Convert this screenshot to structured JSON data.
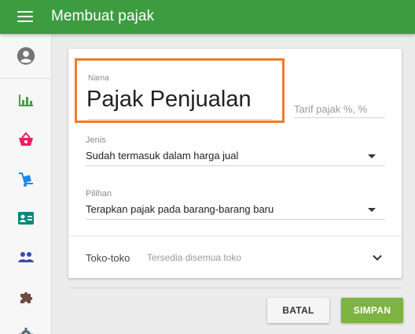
{
  "appbar": {
    "title": "Membuat pajak"
  },
  "form": {
    "name_label": "Nama",
    "name_value": "Pajak Penjualan",
    "rate_placeholder": "Tarif pajak %, %",
    "type_label": "Jenis",
    "type_value": "Sudah termasuk dalam harga jual",
    "option_label": "Pilihan",
    "option_value": "Terapkan pajak pada barang-barang baru",
    "stores_label": "Toko-toko",
    "stores_value": "Tersedia disemua toko"
  },
  "buttons": {
    "cancel": "BATAL",
    "save": "SIMPAN"
  },
  "colors": {
    "appbar": "#3d9b40",
    "save_button": "#7cb342",
    "highlight": "#ef7b2a"
  }
}
